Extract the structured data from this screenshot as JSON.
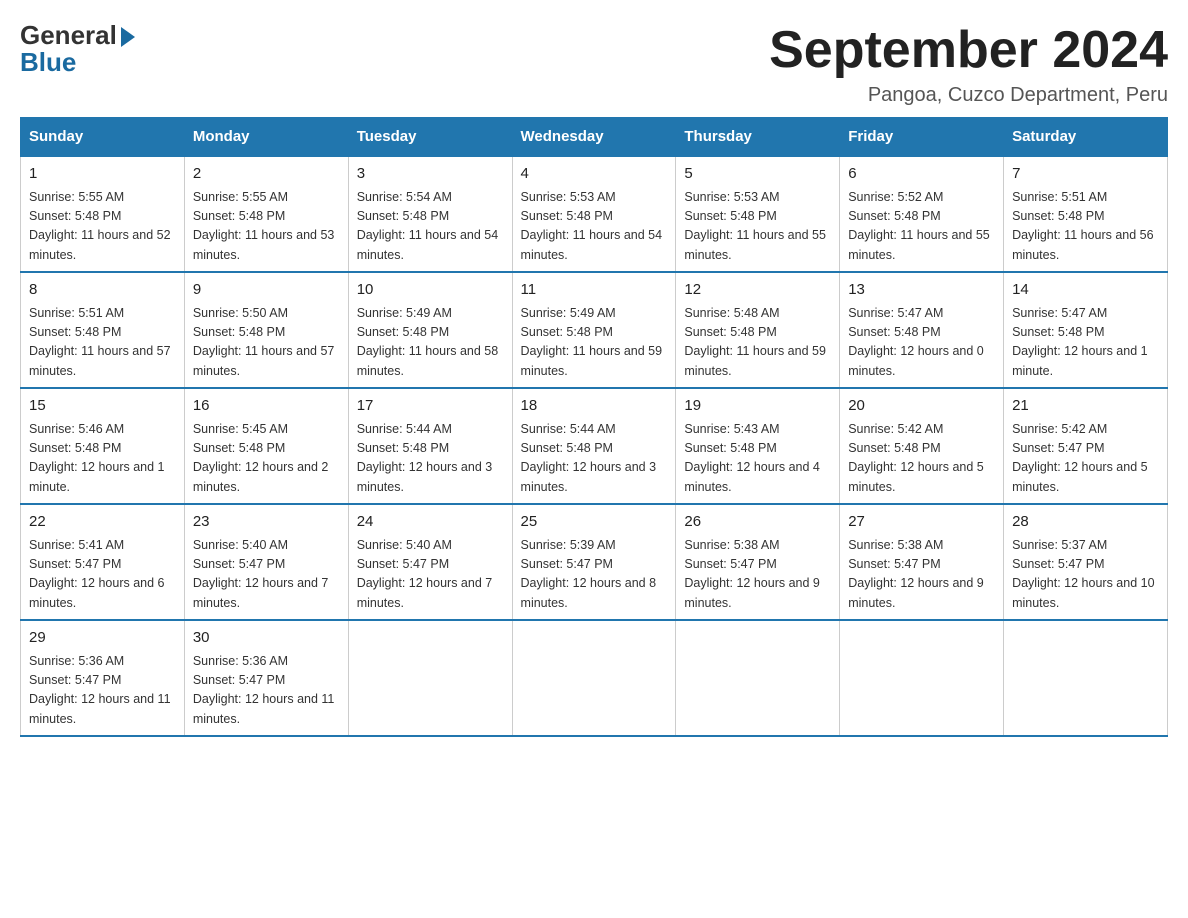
{
  "logo": {
    "general": "General",
    "blue": "Blue"
  },
  "title": "September 2024",
  "location": "Pangoa, Cuzco Department, Peru",
  "days_of_week": [
    "Sunday",
    "Monday",
    "Tuesday",
    "Wednesday",
    "Thursday",
    "Friday",
    "Saturday"
  ],
  "weeks": [
    [
      {
        "day": "1",
        "sunrise": "5:55 AM",
        "sunset": "5:48 PM",
        "daylight": "11 hours and 52 minutes."
      },
      {
        "day": "2",
        "sunrise": "5:55 AM",
        "sunset": "5:48 PM",
        "daylight": "11 hours and 53 minutes."
      },
      {
        "day": "3",
        "sunrise": "5:54 AM",
        "sunset": "5:48 PM",
        "daylight": "11 hours and 54 minutes."
      },
      {
        "day": "4",
        "sunrise": "5:53 AM",
        "sunset": "5:48 PM",
        "daylight": "11 hours and 54 minutes."
      },
      {
        "day": "5",
        "sunrise": "5:53 AM",
        "sunset": "5:48 PM",
        "daylight": "11 hours and 55 minutes."
      },
      {
        "day": "6",
        "sunrise": "5:52 AM",
        "sunset": "5:48 PM",
        "daylight": "11 hours and 55 minutes."
      },
      {
        "day": "7",
        "sunrise": "5:51 AM",
        "sunset": "5:48 PM",
        "daylight": "11 hours and 56 minutes."
      }
    ],
    [
      {
        "day": "8",
        "sunrise": "5:51 AM",
        "sunset": "5:48 PM",
        "daylight": "11 hours and 57 minutes."
      },
      {
        "day": "9",
        "sunrise": "5:50 AM",
        "sunset": "5:48 PM",
        "daylight": "11 hours and 57 minutes."
      },
      {
        "day": "10",
        "sunrise": "5:49 AM",
        "sunset": "5:48 PM",
        "daylight": "11 hours and 58 minutes."
      },
      {
        "day": "11",
        "sunrise": "5:49 AM",
        "sunset": "5:48 PM",
        "daylight": "11 hours and 59 minutes."
      },
      {
        "day": "12",
        "sunrise": "5:48 AM",
        "sunset": "5:48 PM",
        "daylight": "11 hours and 59 minutes."
      },
      {
        "day": "13",
        "sunrise": "5:47 AM",
        "sunset": "5:48 PM",
        "daylight": "12 hours and 0 minutes."
      },
      {
        "day": "14",
        "sunrise": "5:47 AM",
        "sunset": "5:48 PM",
        "daylight": "12 hours and 1 minute."
      }
    ],
    [
      {
        "day": "15",
        "sunrise": "5:46 AM",
        "sunset": "5:48 PM",
        "daylight": "12 hours and 1 minute."
      },
      {
        "day": "16",
        "sunrise": "5:45 AM",
        "sunset": "5:48 PM",
        "daylight": "12 hours and 2 minutes."
      },
      {
        "day": "17",
        "sunrise": "5:44 AM",
        "sunset": "5:48 PM",
        "daylight": "12 hours and 3 minutes."
      },
      {
        "day": "18",
        "sunrise": "5:44 AM",
        "sunset": "5:48 PM",
        "daylight": "12 hours and 3 minutes."
      },
      {
        "day": "19",
        "sunrise": "5:43 AM",
        "sunset": "5:48 PM",
        "daylight": "12 hours and 4 minutes."
      },
      {
        "day": "20",
        "sunrise": "5:42 AM",
        "sunset": "5:48 PM",
        "daylight": "12 hours and 5 minutes."
      },
      {
        "day": "21",
        "sunrise": "5:42 AM",
        "sunset": "5:47 PM",
        "daylight": "12 hours and 5 minutes."
      }
    ],
    [
      {
        "day": "22",
        "sunrise": "5:41 AM",
        "sunset": "5:47 PM",
        "daylight": "12 hours and 6 minutes."
      },
      {
        "day": "23",
        "sunrise": "5:40 AM",
        "sunset": "5:47 PM",
        "daylight": "12 hours and 7 minutes."
      },
      {
        "day": "24",
        "sunrise": "5:40 AM",
        "sunset": "5:47 PM",
        "daylight": "12 hours and 7 minutes."
      },
      {
        "day": "25",
        "sunrise": "5:39 AM",
        "sunset": "5:47 PM",
        "daylight": "12 hours and 8 minutes."
      },
      {
        "day": "26",
        "sunrise": "5:38 AM",
        "sunset": "5:47 PM",
        "daylight": "12 hours and 9 minutes."
      },
      {
        "day": "27",
        "sunrise": "5:38 AM",
        "sunset": "5:47 PM",
        "daylight": "12 hours and 9 minutes."
      },
      {
        "day": "28",
        "sunrise": "5:37 AM",
        "sunset": "5:47 PM",
        "daylight": "12 hours and 10 minutes."
      }
    ],
    [
      {
        "day": "29",
        "sunrise": "5:36 AM",
        "sunset": "5:47 PM",
        "daylight": "12 hours and 11 minutes."
      },
      {
        "day": "30",
        "sunrise": "5:36 AM",
        "sunset": "5:47 PM",
        "daylight": "12 hours and 11 minutes."
      },
      null,
      null,
      null,
      null,
      null
    ]
  ]
}
